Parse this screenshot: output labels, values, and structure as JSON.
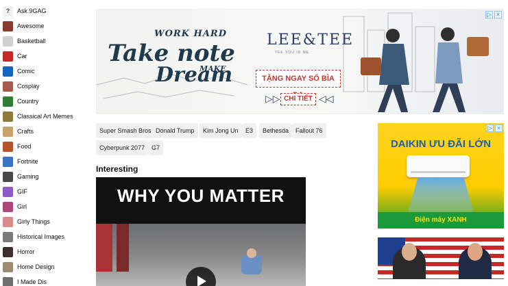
{
  "sidebar": {
    "items": [
      {
        "label": "Ask 9GAG",
        "color": "#f2f2f2",
        "glyph": "?"
      },
      {
        "label": "Awesome",
        "color": "#8a3b2c",
        "glyph": ""
      },
      {
        "label": "Basketball",
        "color": "#d1d1d1",
        "glyph": ""
      },
      {
        "label": "Car",
        "color": "#c62828",
        "glyph": ""
      },
      {
        "label": "Comic",
        "color": "#1565c0",
        "glyph": ""
      },
      {
        "label": "Cosplay",
        "color": "#a85a4a",
        "glyph": ""
      },
      {
        "label": "Country",
        "color": "#2e7d32",
        "glyph": ""
      },
      {
        "label": "Classical Art Memes",
        "color": "#8d7b3a",
        "glyph": ""
      },
      {
        "label": "Crafts",
        "color": "#c9a26a",
        "glyph": ""
      },
      {
        "label": "Food",
        "color": "#b8542c",
        "glyph": ""
      },
      {
        "label": "Fortnite",
        "color": "#3a74c4",
        "glyph": ""
      },
      {
        "label": "Gaming",
        "color": "#4a4a4a",
        "glyph": ""
      },
      {
        "label": "GIF",
        "color": "#8e5cc7",
        "glyph": ""
      },
      {
        "label": "Girl",
        "color": "#b0457c",
        "glyph": ""
      },
      {
        "label": "Girly Things",
        "color": "#d98a8a",
        "glyph": ""
      },
      {
        "label": "Historical Images",
        "color": "#7a7a7a",
        "glyph": ""
      },
      {
        "label": "Horror",
        "color": "#3b2f2f",
        "glyph": ""
      },
      {
        "label": "Home Design",
        "color": "#9e8a6e",
        "glyph": ""
      },
      {
        "label": "I Made Dis",
        "color": "#6e6e6e",
        "glyph": ""
      }
    ]
  },
  "top_ad": {
    "slogan_1": "WORK HARD",
    "slogan_2": "Take note",
    "slogan_3": "MAKE",
    "slogan_4": "Dream",
    "brand": "LEE&TEE",
    "brand_sub": "TEE YOU IN ME",
    "promo": "TẶNG NGAY SỔ BÌA DA",
    "cta": "CHI TIẾT",
    "info_icon": "▷",
    "close_icon": "×"
  },
  "tags": [
    "Super Smash Bros",
    "Donald Trump",
    "Kim Jong Un",
    "E3",
    "Bethesda",
    "Fallout 76",
    "Cyberpunk 2077",
    "G7"
  ],
  "section": {
    "title": "Interesting"
  },
  "post": {
    "title": "WHY YOU MATTER"
  },
  "right_ad": {
    "headline": "DAIKIN ƯU ĐÃI LỚN",
    "footer": "Điện máy XANH",
    "info_icon": "▷",
    "close_icon": "×"
  },
  "colors": {
    "daikin_blue": "#1a5fb4",
    "dmx_green": "#1a9a3a",
    "promo_red": "#c0392b",
    "brand_navy": "#2b3e6d"
  }
}
